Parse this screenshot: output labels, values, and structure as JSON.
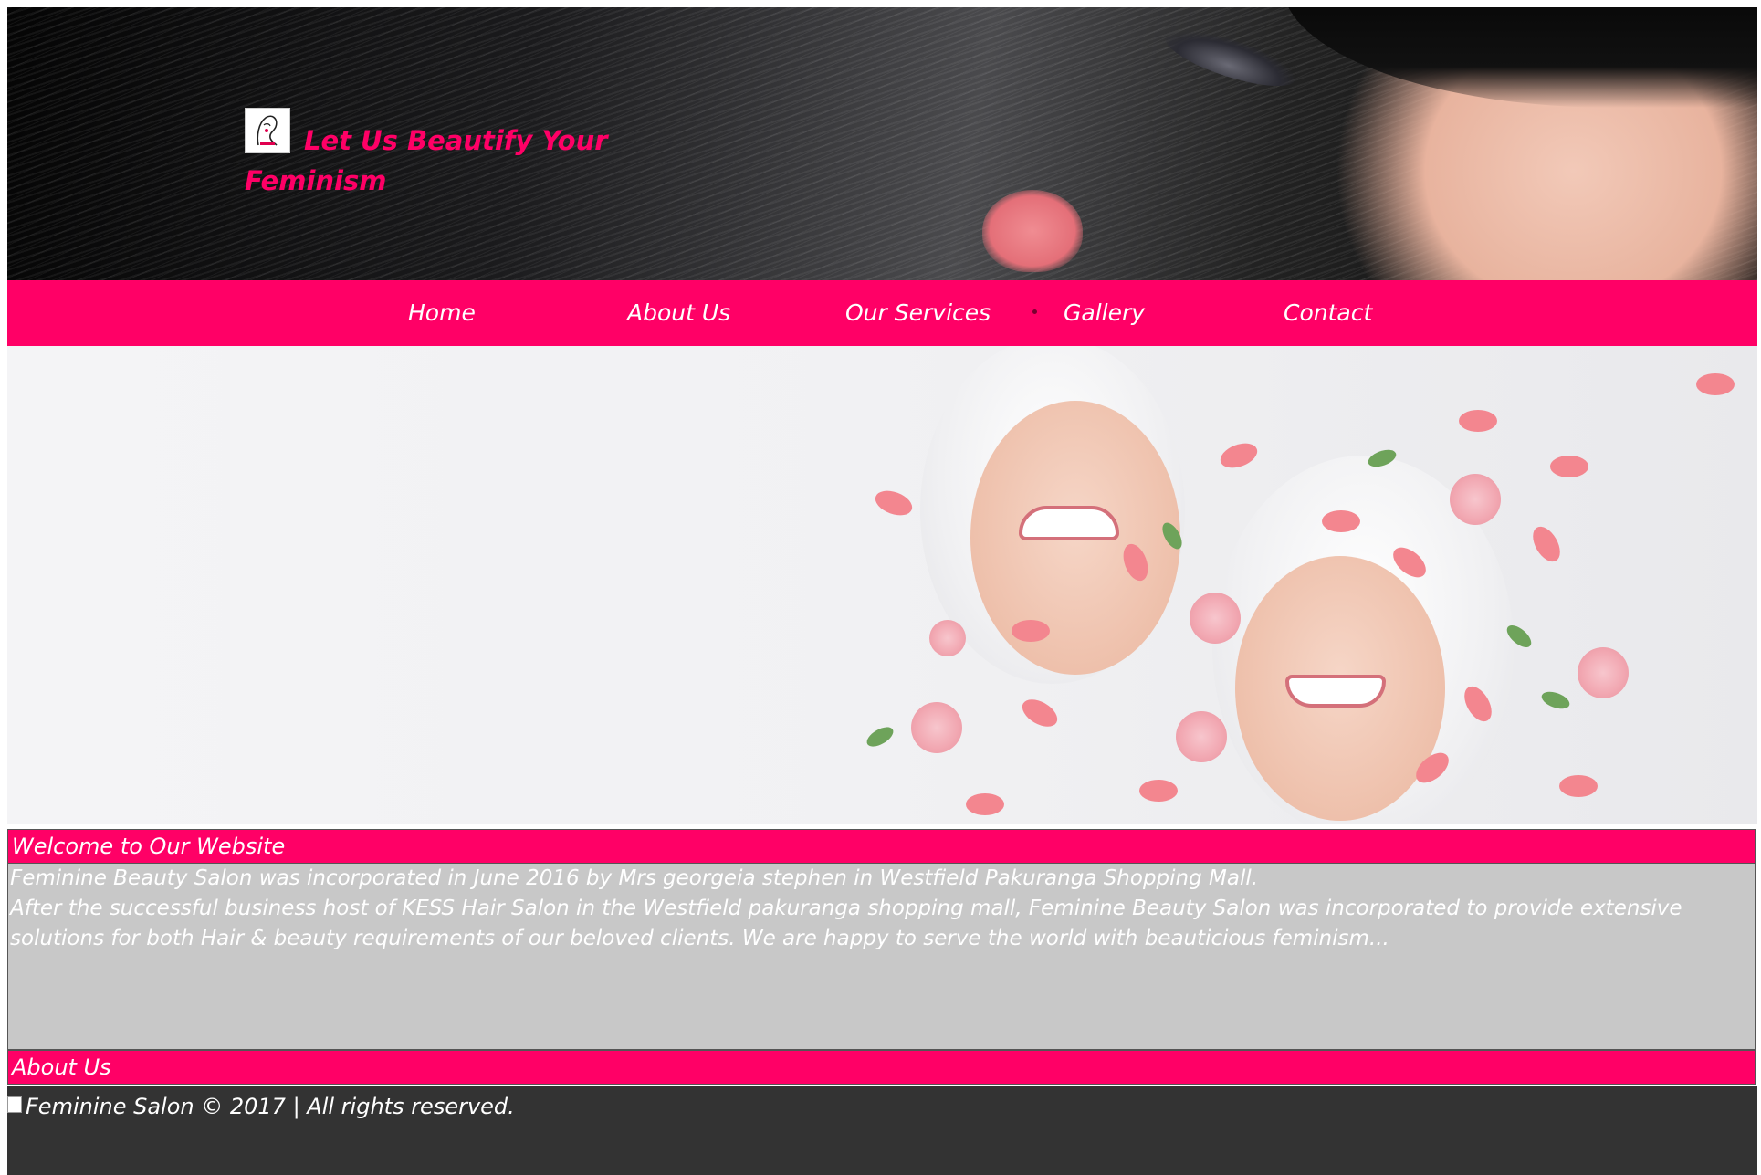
{
  "header": {
    "tagline": "Let Us Beautify Your Feminism"
  },
  "nav": {
    "items": [
      {
        "label": "Home"
      },
      {
        "label": "About Us"
      },
      {
        "label": "Our Services"
      },
      {
        "label": "Gallery"
      },
      {
        "label": "Contact"
      }
    ]
  },
  "welcome": {
    "title": "Welcome to Our Website",
    "line1": "Feminine Beauty Salon was incorporated in June 2016 by Mrs georgeia stephen in Westfield Pakuranga Shopping Mall.",
    "line2": "After the successful business host of KESS Hair Salon in the Westfield pakuranga shopping mall, Feminine Beauty Salon was incorporated to provide extensive solutions for both Hair & beauty requirements of our beloved clients. We are happy to serve the world with beauticious feminism..."
  },
  "about": {
    "title": "About Us"
  },
  "footer": {
    "text": "Feminine Salon © 2017 | All rights reserved."
  },
  "colors": {
    "accent": "#ff0066",
    "footer_bg": "#333333",
    "content_bg": "#c8c8c8"
  }
}
